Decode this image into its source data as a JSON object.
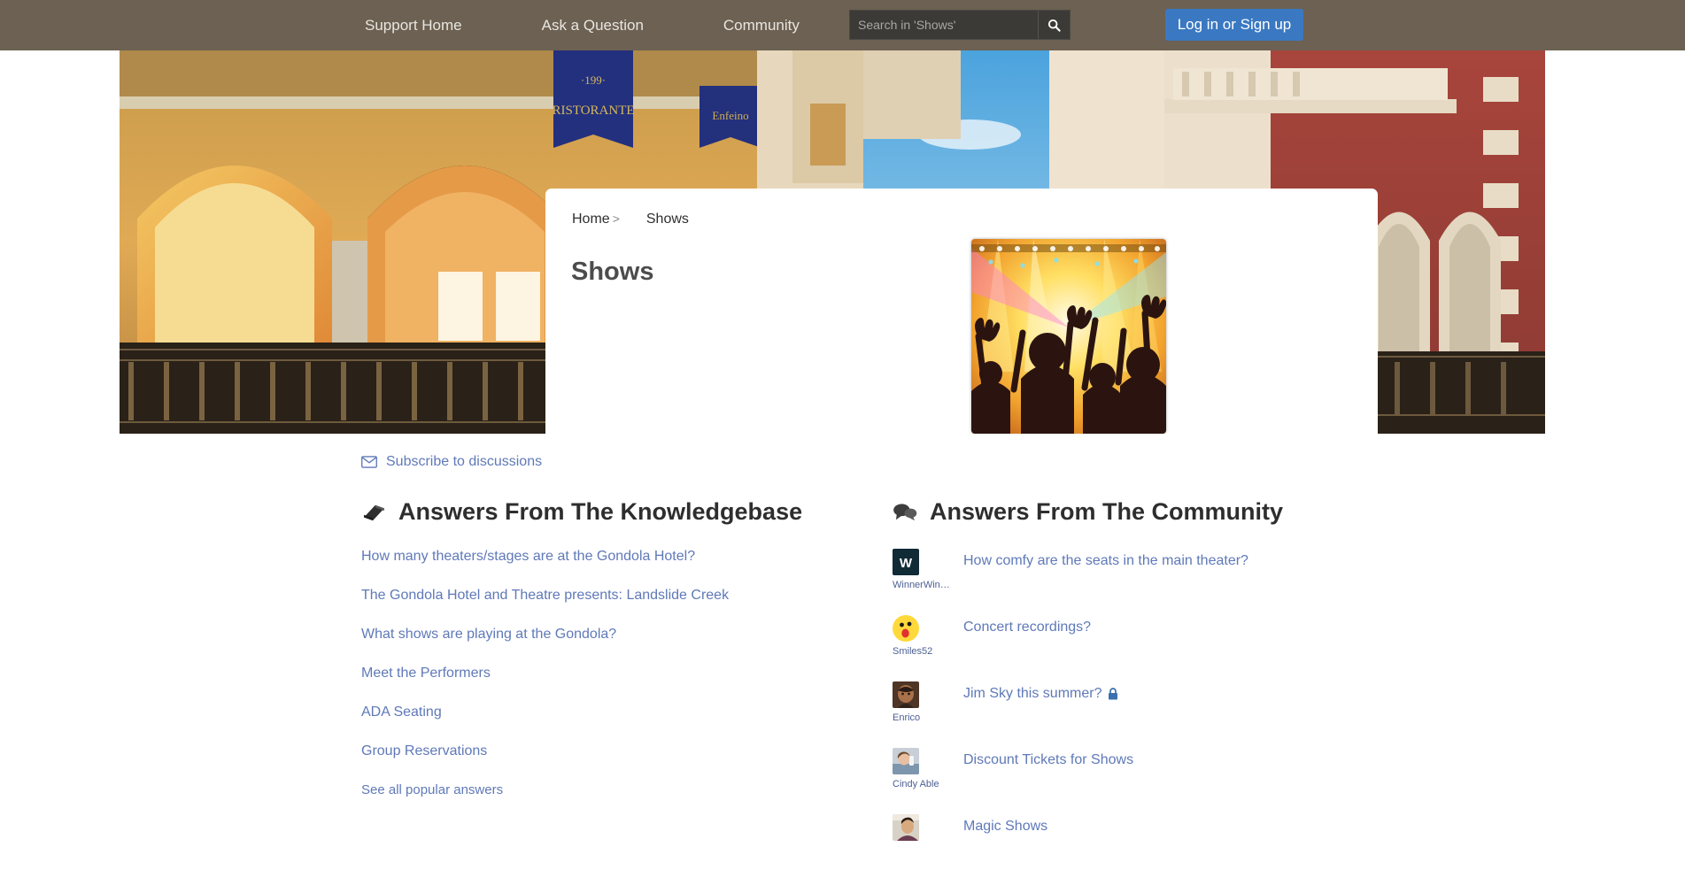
{
  "nav": {
    "links": [
      {
        "label": "Support Home",
        "icon": "home-icon"
      },
      {
        "label": "Ask a Question",
        "icon": "question-icon"
      },
      {
        "label": "Community",
        "icon": "community-icon"
      }
    ],
    "search": {
      "placeholder": "Search in 'Shows'",
      "value": "",
      "button_icon": "search-icon"
    },
    "login_label": "Log in or Sign up",
    "colors": {
      "bar": "#6c6152",
      "login_button": "#3a78c2",
      "search_field": "#3b3a36"
    }
  },
  "hero": {
    "breadcrumb": {
      "home": "Home",
      "separator": ">",
      "current": "Shows"
    },
    "title": "Shows",
    "thumbnail_alt": "concert-crowd-image"
  },
  "subscribe": {
    "label": "Subscribe to discussions",
    "icon": "envelope-icon"
  },
  "knowledgebase": {
    "icon": "book-icon",
    "title": "Answers From The Knowledgebase",
    "links": [
      "How many theaters/stages are at the Gondola Hotel?",
      "The Gondola Hotel and Theatre presents: Landslide Creek",
      "What shows are playing at the Gondola?",
      "Meet the Performers",
      "ADA Seating",
      "Group Reservations"
    ],
    "more_label": "See all popular answers"
  },
  "community": {
    "icon": "speech-bubbles-icon",
    "title": "Answers From The Community",
    "items": [
      {
        "user": "WinnerWin…",
        "title": "How comfy are the seats in the main theater?",
        "avatar": "letter-w-avatar",
        "locked": false
      },
      {
        "user": "Smiles52",
        "title": "Concert recordings?",
        "avatar": "surprised-emoji-avatar",
        "locked": false
      },
      {
        "user": "Enrico",
        "title": "Jim Sky this summer?",
        "avatar": "photo-avatar-enrico",
        "locked": true,
        "lock_icon": "lock-icon"
      },
      {
        "user": "Cindy Able",
        "title": "Discount Tickets for Shows",
        "avatar": "photo-avatar-cindy",
        "locked": false
      },
      {
        "user": "",
        "title": "Magic Shows",
        "avatar": "photo-avatar-magic",
        "locked": false
      }
    ]
  },
  "colors": {
    "link": "#5f79b8",
    "heading": "#2e2e2e",
    "lock": "#3a6fb0"
  }
}
